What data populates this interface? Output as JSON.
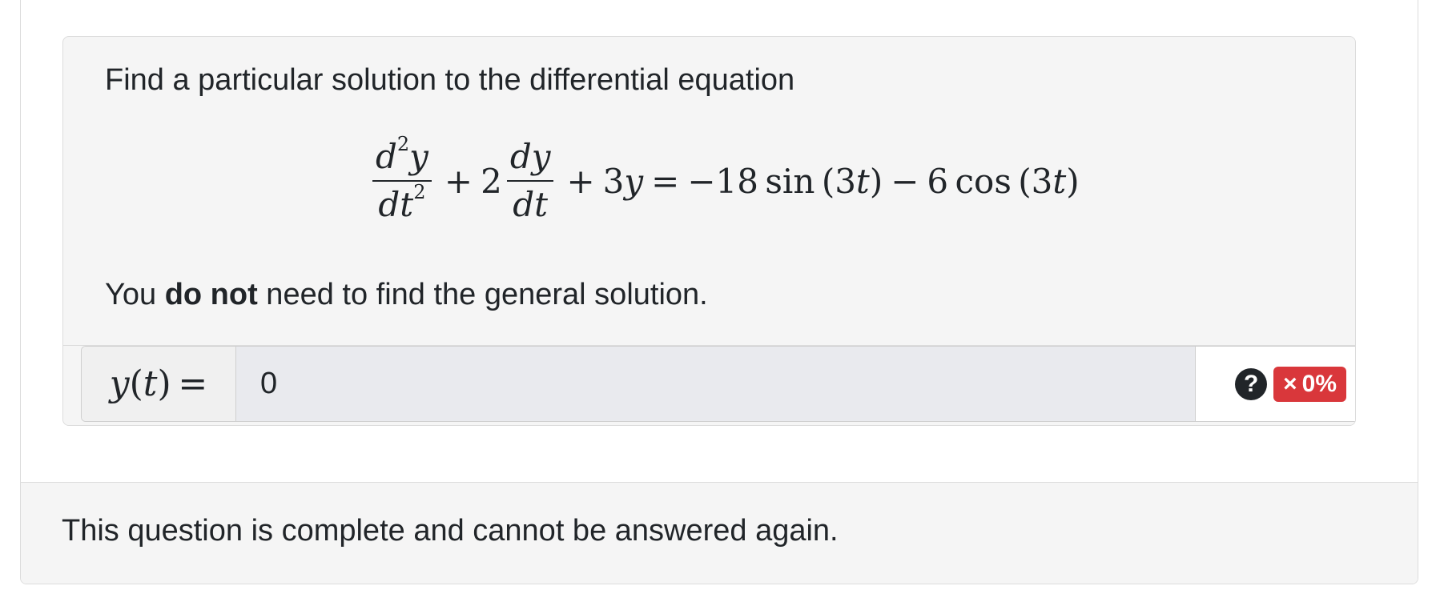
{
  "question": {
    "prompt": "Find a particular solution to the differential equation",
    "equation": {
      "d2y_num_d": "d",
      "d2y_num_exp": "2",
      "d2y_num_y": "y",
      "d2y_den_dt": "dt",
      "d2y_den_exp": "2",
      "plus1": "+",
      "coef2": "2",
      "dy_num": "dy",
      "dy_den": "dt",
      "plus2": "+",
      "term3": "3",
      "term3_var": "y",
      "equals": "=",
      "rhs_coef1": "−18",
      "rhs_fn1": "sin",
      "rhs_arg1_open": "(3",
      "rhs_arg1_var": "t",
      "rhs_arg1_close": ")",
      "minus": "−",
      "rhs_coef2": "6",
      "rhs_fn2": "cos",
      "rhs_arg2_open": "(3",
      "rhs_arg2_var": "t",
      "rhs_arg2_close": ")"
    },
    "note_prefix": "You ",
    "note_bold": "do not",
    "note_suffix": " need to find the general solution."
  },
  "answer": {
    "label_var": "y",
    "label_open": "(",
    "label_t": "t",
    "label_close": ")",
    "label_eq": "=",
    "value": "0",
    "help_symbol": "?",
    "score_symbol": "×",
    "score_value": "0%"
  },
  "footer": {
    "message": "This question is complete and cannot be answered again."
  },
  "colors": {
    "score_badge": "#d9373b",
    "panel_bg": "#f5f5f5",
    "input_bg": "#e9eaee"
  }
}
